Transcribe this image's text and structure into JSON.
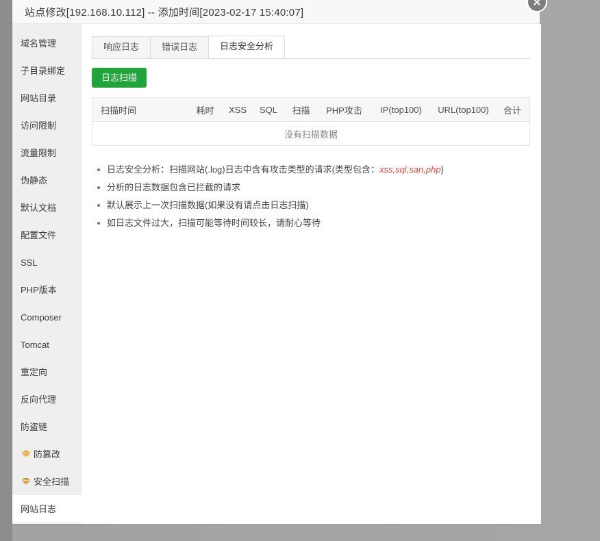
{
  "dialog": {
    "title": "站点修改[192.168.10.112] -- 添加时间[2023-02-17 15:40:07]",
    "close_icon": "close-icon"
  },
  "sidebar": {
    "items": [
      {
        "label": "域名管理",
        "icon": null,
        "selected": false
      },
      {
        "label": "子目录绑定",
        "icon": null,
        "selected": false
      },
      {
        "label": "网站目录",
        "icon": null,
        "selected": false
      },
      {
        "label": "访问限制",
        "icon": null,
        "selected": false
      },
      {
        "label": "流量限制",
        "icon": null,
        "selected": false
      },
      {
        "label": "伪静态",
        "icon": null,
        "selected": false
      },
      {
        "label": "默认文档",
        "icon": null,
        "selected": false
      },
      {
        "label": "配置文件",
        "icon": null,
        "selected": false
      },
      {
        "label": "SSL",
        "icon": null,
        "selected": false
      },
      {
        "label": "PHP版本",
        "icon": null,
        "selected": false
      },
      {
        "label": "Composer",
        "icon": null,
        "selected": false
      },
      {
        "label": "Tomcat",
        "icon": null,
        "selected": false
      },
      {
        "label": "重定向",
        "icon": null,
        "selected": false
      },
      {
        "label": "反向代理",
        "icon": null,
        "selected": false
      },
      {
        "label": "防盗链",
        "icon": null,
        "selected": false
      },
      {
        "label": "防篡改",
        "icon": "gem-icon",
        "selected": false
      },
      {
        "label": "安全扫描",
        "icon": "gem-icon",
        "selected": false
      },
      {
        "label": "网站日志",
        "icon": null,
        "selected": true
      }
    ]
  },
  "main": {
    "tabs": [
      {
        "label": "响应日志",
        "active": false
      },
      {
        "label": "错误日志",
        "active": false
      },
      {
        "label": "日志安全分析",
        "active": true
      }
    ],
    "scan_button": "日志扫描",
    "table": {
      "headers": [
        "扫描时间",
        "耗时",
        "XSS",
        "SQL",
        "扫描",
        "PHP攻击",
        "IP(top100)",
        "URL(top100)",
        "合计"
      ],
      "rows": [],
      "empty_text": "没有扫描数据"
    },
    "notes": [
      {
        "text_before": "日志安全分析：扫描网站(.log)日志中含有攻击类型的请求(类型包含：",
        "emphasis": "xss,sql,san,php",
        "text_after": ")"
      },
      {
        "text_before": "分析的日志数据包含已拦截的请求",
        "emphasis": "",
        "text_after": ""
      },
      {
        "text_before": "默认展示上一次扫描数据(如果没有请点击日志扫描)",
        "emphasis": "",
        "text_after": ""
      },
      {
        "text_before": "如日志文件过大，扫描可能等待时间较长，请耐心等待",
        "emphasis": "",
        "text_after": ""
      }
    ]
  },
  "colors": {
    "accent_green": "#20a53a",
    "emphasis_red": "#e8453c",
    "sidebar_bg": "#efefef",
    "gem_icon": "#f0a020"
  }
}
